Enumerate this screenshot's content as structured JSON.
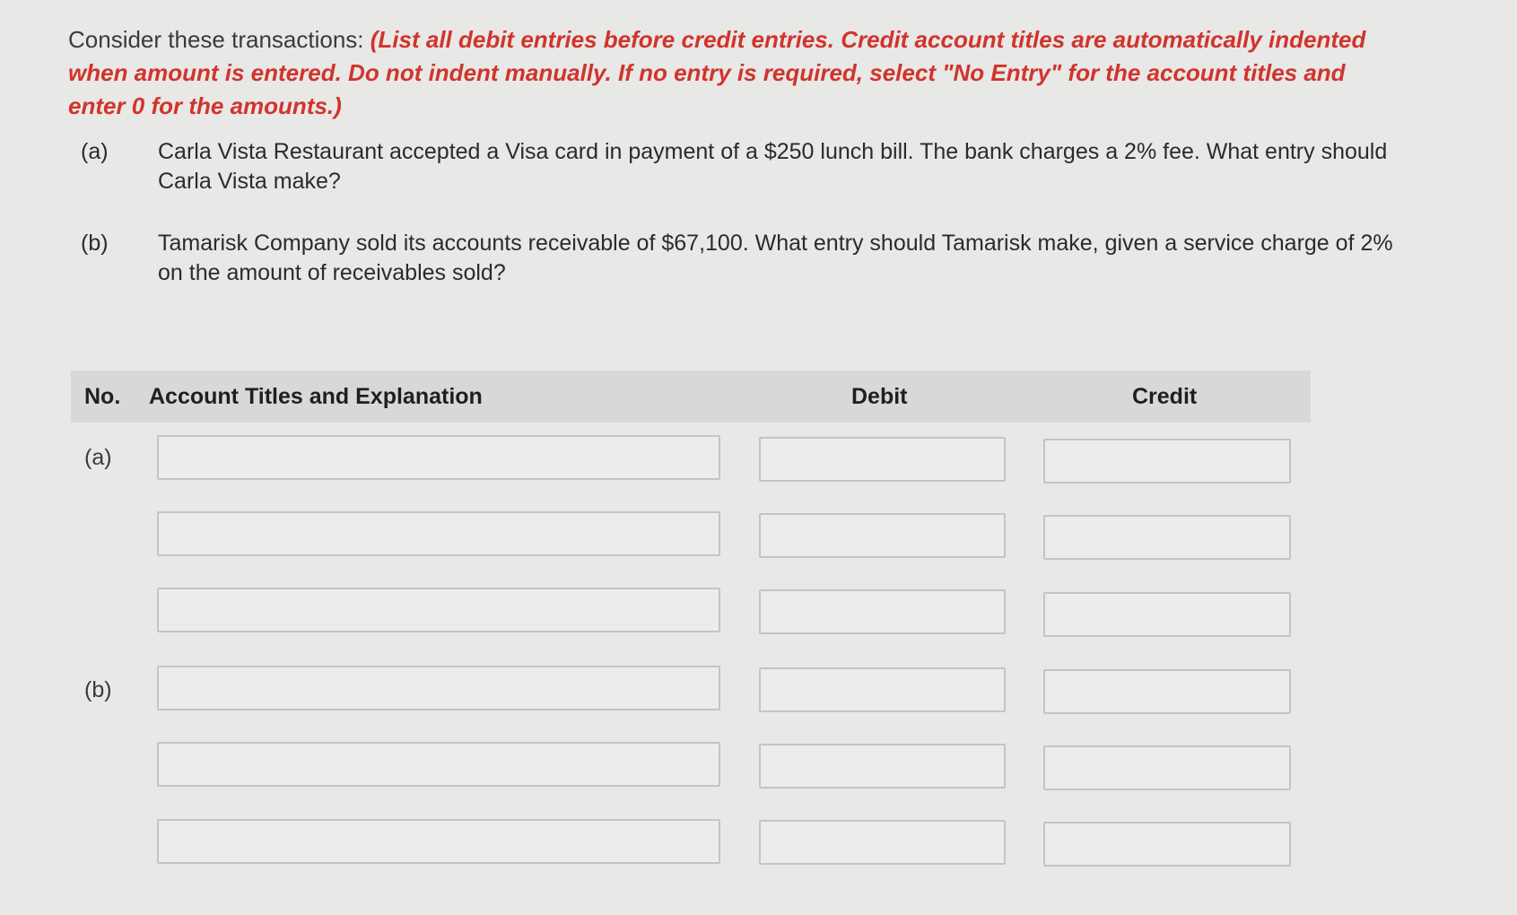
{
  "instructions": {
    "lead": "Consider these transactions:",
    "note": "(List all debit entries before credit entries. Credit account titles are automatically indented when amount is entered. Do not indent manually. If no entry is required, select \"No Entry\" for the account titles and enter 0 for the amounts.)"
  },
  "questions": [
    {
      "label": "(a)",
      "text": "Carla Vista Restaurant accepted a Visa card in payment of a $250 lunch bill. The bank charges a 2% fee. What entry should Carla Vista make?"
    },
    {
      "label": "(b)",
      "text": "Tamarisk Company sold its accounts receivable of $67,100. What entry should Tamarisk make, given a service charge of 2% on the amount of receivables sold?"
    }
  ],
  "table": {
    "headers": {
      "no": "No.",
      "account": "Account Titles and Explanation",
      "debit": "Debit",
      "credit": "Credit"
    },
    "groups": [
      {
        "label": "(a)",
        "rows": [
          {
            "account": "",
            "debit": "",
            "credit": ""
          },
          {
            "account": "",
            "debit": "",
            "credit": ""
          },
          {
            "account": "",
            "debit": "",
            "credit": ""
          }
        ]
      },
      {
        "label": "(b)",
        "rows": [
          {
            "account": "",
            "debit": "",
            "credit": ""
          },
          {
            "account": "",
            "debit": "",
            "credit": ""
          },
          {
            "account": "",
            "debit": "",
            "credit": ""
          }
        ]
      }
    ]
  }
}
